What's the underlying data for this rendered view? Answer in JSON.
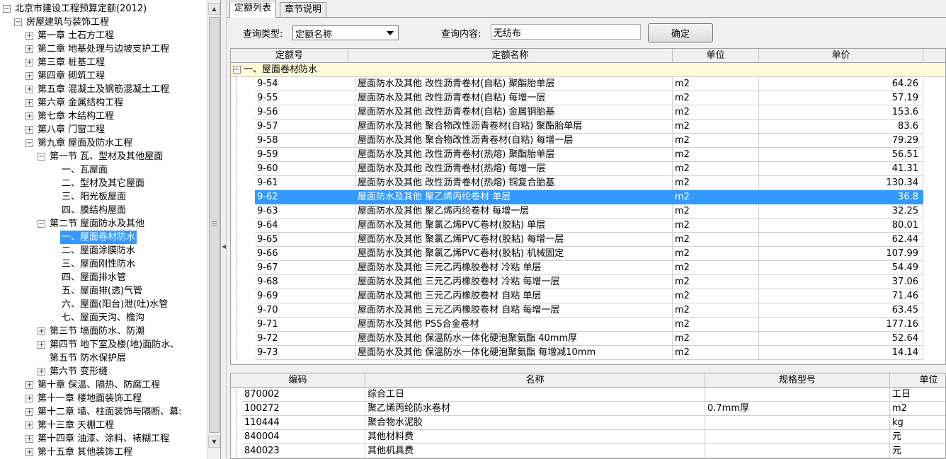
{
  "tree": {
    "nodes": [
      {
        "label": "北京市建设工程预算定额(2012)",
        "level": 0,
        "toggle": "−"
      },
      {
        "label": "房屋建筑与装饰工程",
        "level": 1,
        "toggle": "−"
      },
      {
        "label": "第一章 土石方工程",
        "level": 2,
        "toggle": "+"
      },
      {
        "label": "第二章 地基处理与边坡支护工程",
        "level": 2,
        "toggle": "+"
      },
      {
        "label": "第三章 桩基工程",
        "level": 2,
        "toggle": "+"
      },
      {
        "label": "第四章 砌筑工程",
        "level": 2,
        "toggle": "+"
      },
      {
        "label": "第五章 混凝土及钢筋混凝土工程",
        "level": 2,
        "toggle": "+"
      },
      {
        "label": "第六章 金属结构工程",
        "level": 2,
        "toggle": "+"
      },
      {
        "label": "第七章 木结构工程",
        "level": 2,
        "toggle": "+"
      },
      {
        "label": "第八章 门窗工程",
        "level": 2,
        "toggle": "+"
      },
      {
        "label": "第九章 屋面及防水工程",
        "level": 2,
        "toggle": "−"
      },
      {
        "label": "第一节 瓦、型材及其他屋面",
        "level": 3,
        "toggle": "−"
      },
      {
        "label": "一、瓦屋面",
        "level": 4,
        "toggle": ""
      },
      {
        "label": "二、型材及其它屋面",
        "level": 4,
        "toggle": ""
      },
      {
        "label": "三、阳光板屋面",
        "level": 4,
        "toggle": ""
      },
      {
        "label": "四、膜结构屋面",
        "level": 4,
        "toggle": ""
      },
      {
        "label": "第二节 屋面防水及其他",
        "level": 3,
        "toggle": "−"
      },
      {
        "label": "一、屋面卷材防水",
        "level": 4,
        "toggle": "",
        "selected": true
      },
      {
        "label": "二、屋面涂膜防水",
        "level": 4,
        "toggle": ""
      },
      {
        "label": "三、屋面刚性防水",
        "level": 4,
        "toggle": ""
      },
      {
        "label": "四、屋面排水管",
        "level": 4,
        "toggle": ""
      },
      {
        "label": "五、屋面排(透)气管",
        "level": 4,
        "toggle": ""
      },
      {
        "label": "六、屋面(阳台)泄(吐)水管",
        "level": 4,
        "toggle": ""
      },
      {
        "label": "七、屋面天沟、檐沟",
        "level": 4,
        "toggle": ""
      },
      {
        "label": "第三节 墙面防水、防潮",
        "level": 3,
        "toggle": "+"
      },
      {
        "label": "第四节 地下室及楼(地)面防水、",
        "level": 3,
        "toggle": "+"
      },
      {
        "label": "第五节 防水保护层",
        "level": 3,
        "toggle": ""
      },
      {
        "label": "第六节 变形缝",
        "level": 3,
        "toggle": "+"
      },
      {
        "label": "第十章 保温、隔热、防腐工程",
        "level": 2,
        "toggle": "+"
      },
      {
        "label": "第十一章 楼地面装饰工程",
        "level": 2,
        "toggle": "+"
      },
      {
        "label": "第十二章 墙、柱面装饰与隔断、幕:",
        "level": 2,
        "toggle": "+"
      },
      {
        "label": "第十三章 天棚工程",
        "level": 2,
        "toggle": "+"
      },
      {
        "label": "第十四章 油漆、涂料、裱糊工程",
        "level": 2,
        "toggle": "+"
      },
      {
        "label": "第十五章 其他装饰工程",
        "level": 2,
        "toggle": "+"
      }
    ]
  },
  "tabs": [
    {
      "label": "定额列表",
      "active": true
    },
    {
      "label": "章节说明",
      "active": false
    }
  ],
  "query": {
    "type_label": "查询类型:",
    "type_value": "定额名称",
    "content_label": "查询内容:",
    "content_value": "无纺布",
    "confirm_label": "确定"
  },
  "quota_table": {
    "headers": [
      "定额号",
      "定额名称",
      "单位",
      "单价"
    ],
    "group_label": "一、屋面卷材防水",
    "selected_code": "9-62",
    "rows": [
      {
        "code": "9-54",
        "name": "屋面防水及其他 改性沥青卷材(自粘) 聚酯胎单层",
        "unit": "m2",
        "price": "64.26"
      },
      {
        "code": "9-55",
        "name": "屋面防水及其他 改性沥青卷材(自粘) 每增一层",
        "unit": "m2",
        "price": "57.19"
      },
      {
        "code": "9-56",
        "name": "屋面防水及其他 改性沥青卷材(自粘) 金属铜胎基",
        "unit": "m2",
        "price": "153.6"
      },
      {
        "code": "9-57",
        "name": "屋面防水及其他 聚合物改性沥青卷材(自粘) 聚酯胎单层",
        "unit": "m2",
        "price": "83.6"
      },
      {
        "code": "9-58",
        "name": "屋面防水及其他 聚合物改性沥青卷材(自粘) 每增一层",
        "unit": "m2",
        "price": "79.29"
      },
      {
        "code": "9-59",
        "name": "屋面防水及其他 改性沥青卷材(热熔) 聚酯胎单层",
        "unit": "m2",
        "price": "56.51"
      },
      {
        "code": "9-60",
        "name": "屋面防水及其他 改性沥青卷材(热熔) 每增一层",
        "unit": "m2",
        "price": "41.31"
      },
      {
        "code": "9-61",
        "name": "屋面防水及其他 改性沥青卷材(热熔) 铜复合胎基",
        "unit": "m2",
        "price": "130.34"
      },
      {
        "code": "9-62",
        "name": "屋面防水及其他 聚乙烯丙纶卷材 单层",
        "unit": "m2",
        "price": "36.8"
      },
      {
        "code": "9-63",
        "name": "屋面防水及其他 聚乙烯丙纶卷材 每增一层",
        "unit": "m2",
        "price": "32.25"
      },
      {
        "code": "9-64",
        "name": "屋面防水及其他 聚氯乙烯PVC卷材(胶粘) 单层",
        "unit": "m2",
        "price": "80.01"
      },
      {
        "code": "9-65",
        "name": "屋面防水及其他 聚氯乙烯PVC卷材(胶粘) 每增一层",
        "unit": "m2",
        "price": "62.44"
      },
      {
        "code": "9-66",
        "name": "屋面防水及其他 聚氯乙烯PVC卷材(胶粘) 机械固定",
        "unit": "m2",
        "price": "107.99"
      },
      {
        "code": "9-67",
        "name": "屋面防水及其他 三元乙丙橡胶卷材 冷粘 单层",
        "unit": "m2",
        "price": "54.49"
      },
      {
        "code": "9-68",
        "name": "屋面防水及其他 三元乙丙橡胶卷材 冷粘 每增一层",
        "unit": "m2",
        "price": "37.06"
      },
      {
        "code": "9-69",
        "name": "屋面防水及其他 三元乙丙橡胶卷材 自粘 单层",
        "unit": "m2",
        "price": "71.46"
      },
      {
        "code": "9-70",
        "name": "屋面防水及其他 三元乙丙橡胶卷材 自粘 每增一层",
        "unit": "m2",
        "price": "63.45"
      },
      {
        "code": "9-71",
        "name": "屋面防水及其他 PSS合金卷材",
        "unit": "m2",
        "price": "177.16"
      },
      {
        "code": "9-72",
        "name": "屋面防水及其他 保温防水一体化硬泡聚氨酯 40mm厚",
        "unit": "m2",
        "price": "52.64"
      },
      {
        "code": "9-73",
        "name": "屋面防水及其他 保温防水一体化硬泡聚氨酯 每增减10mm",
        "unit": "m2",
        "price": "14.14"
      }
    ]
  },
  "resource_table": {
    "headers": [
      "编码",
      "名称",
      "规格型号",
      "单位"
    ],
    "rows": [
      {
        "code": "870002",
        "name": "综合工日",
        "spec": "",
        "unit": "工日"
      },
      {
        "code": "100272",
        "name": "聚乙烯丙纶防水卷材",
        "spec": "0.7mm厚",
        "unit": "m2"
      },
      {
        "code": "110444",
        "name": "聚合物水泥胶",
        "spec": "",
        "unit": "kg"
      },
      {
        "code": "840004",
        "name": "其他材料费",
        "spec": "",
        "unit": "元"
      },
      {
        "code": "840023",
        "name": "其他机具费",
        "spec": "",
        "unit": "元"
      }
    ]
  },
  "colors": {
    "selection": "#3399ff",
    "group_row": "#fffbd6"
  }
}
